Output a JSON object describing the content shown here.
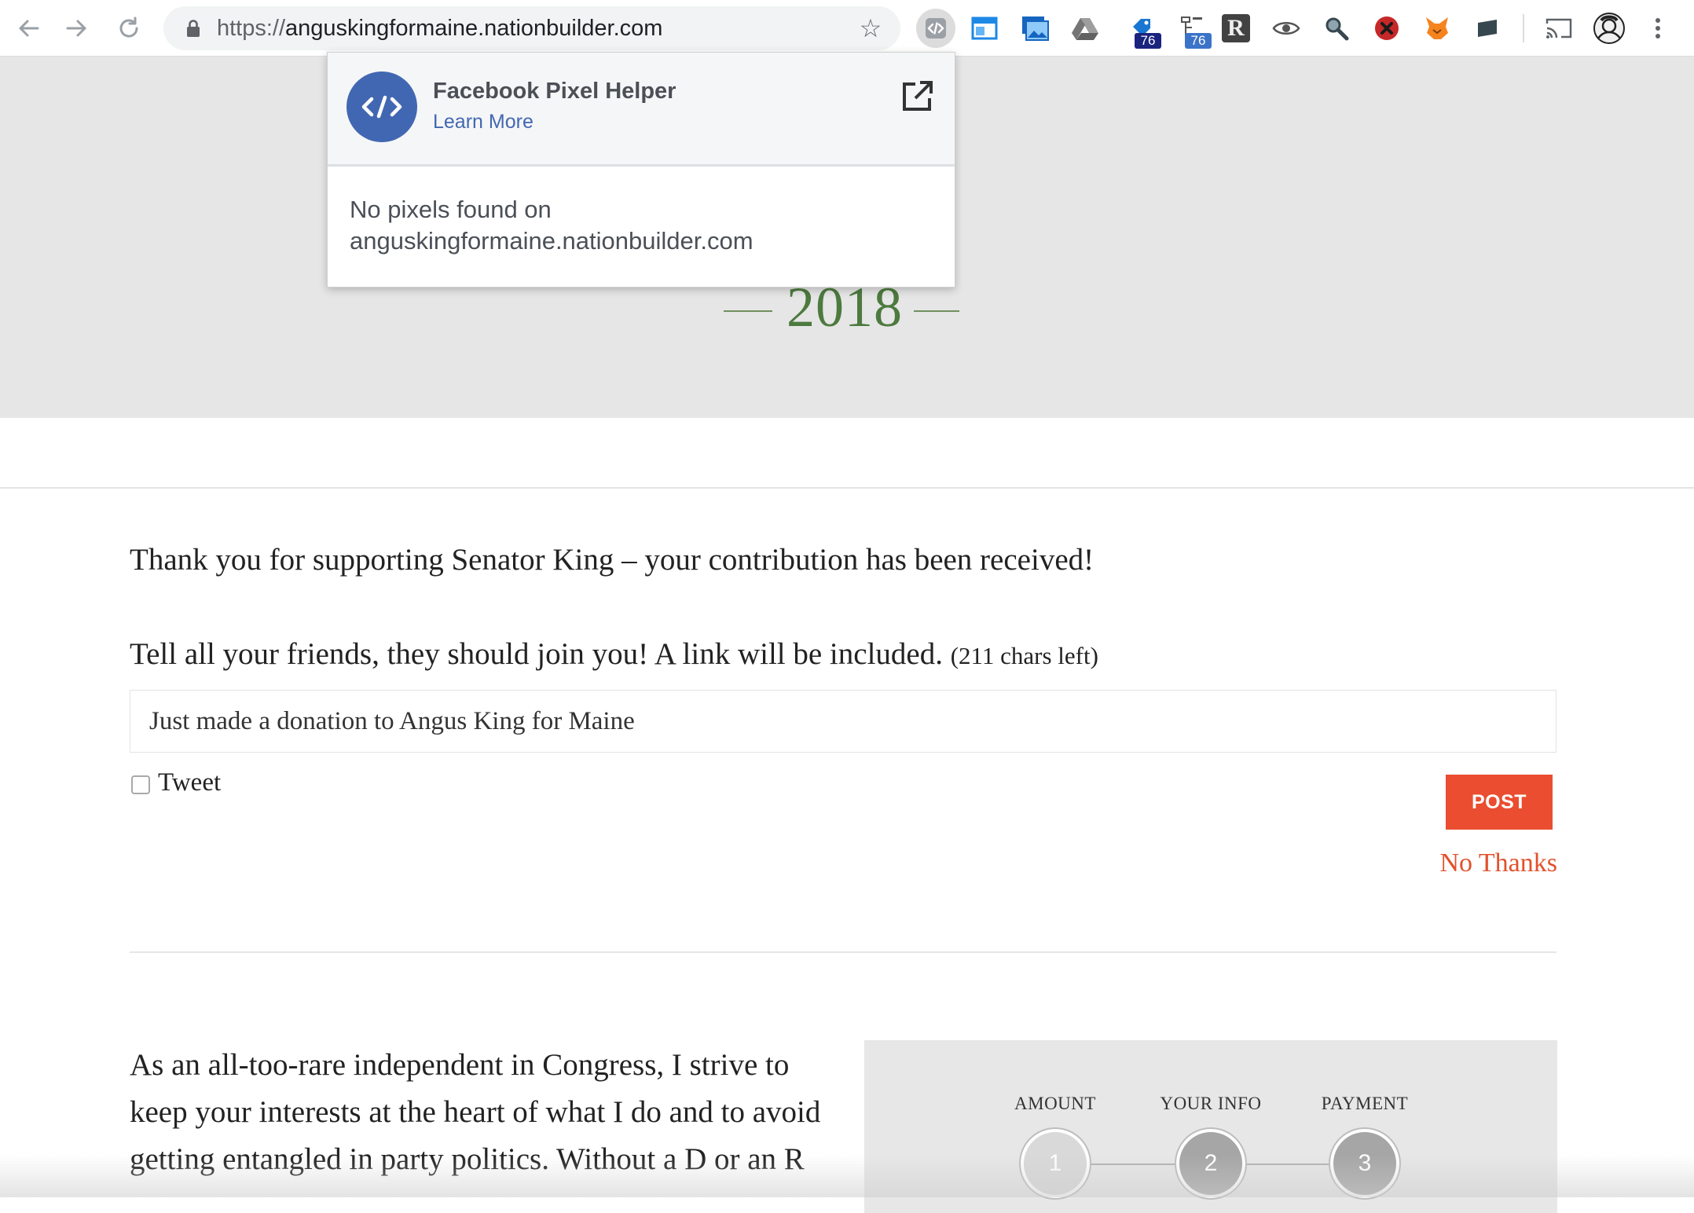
{
  "browser": {
    "url_scheme": "https://",
    "url_host": "anguskingformaine.nationbuilder.com",
    "extensions": [
      {
        "name": "pixel-helper-extension"
      },
      {
        "name": "window-extension"
      },
      {
        "name": "screenshot-extension"
      },
      {
        "name": "drive-extension"
      },
      {
        "name": "tag-extension",
        "badge": "76",
        "badge_color": "#1a237e"
      },
      {
        "name": "sitemap-extension",
        "badge": "76",
        "badge_color": "#3b73c8"
      },
      {
        "name": "r-extension"
      },
      {
        "name": "eye-extension"
      },
      {
        "name": "search-extension"
      },
      {
        "name": "blocker-extension"
      },
      {
        "name": "fox-extension"
      },
      {
        "name": "card-extension"
      },
      {
        "name": "cast-icon"
      },
      {
        "name": "profile-avatar"
      },
      {
        "name": "more-menu"
      }
    ]
  },
  "popup": {
    "title": "Facebook Pixel Helper",
    "learn_more": "Learn More",
    "message_line1": "No pixels found on",
    "message_line2": "anguskingformaine.nationbuilder.com"
  },
  "hero": {
    "year": "2018"
  },
  "page": {
    "thanks": "Thank you for supporting Senator King – your contribution has been received!",
    "share_label": "Tell all your friends, they should join you! A link will be included.",
    "chars_left": "(211 chars left)",
    "share_text": "Just made a donation to Angus King for Maine",
    "tweet_label": "Tweet",
    "post_button": "POST",
    "no_thanks": "No Thanks",
    "para_lines": [
      "As an all-too-rare independent in Congress, I strive to",
      "keep your interests at the heart of what I do and to avoid",
      "getting entangled in party politics. Without a D or an R"
    ]
  },
  "donate_steps": [
    {
      "label": "AMOUNT",
      "number": "1",
      "color": "#d9d9d9"
    },
    {
      "label": "YOUR INFO",
      "number": "2",
      "color": "#a6a6a6"
    },
    {
      "label": "PAYMENT",
      "number": "3",
      "color": "#a6a6a6"
    }
  ],
  "colors": {
    "accent_orange": "#ea4d2f",
    "link_orange": "#e2512d",
    "year_green": "#4d7a3e",
    "facebook_blue": "#4267b2"
  }
}
